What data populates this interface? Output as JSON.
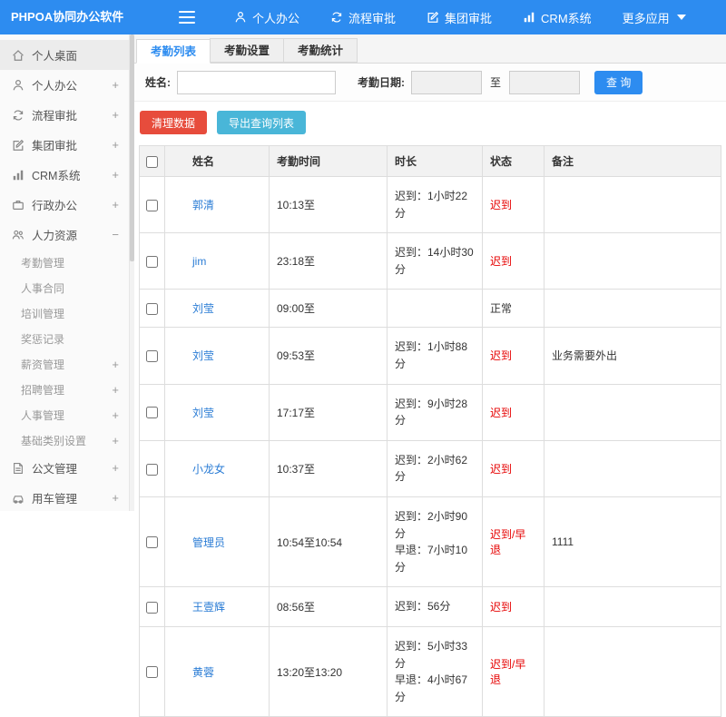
{
  "header": {
    "logo": "PHPOA协同办公软件",
    "nav": [
      {
        "label": "个人办公",
        "icon": "user-icon"
      },
      {
        "label": "流程审批",
        "icon": "process-icon"
      },
      {
        "label": "集团审批",
        "icon": "edit-icon"
      },
      {
        "label": "CRM系统",
        "icon": "chart-icon"
      },
      {
        "label": "更多应用",
        "icon": "chevron-down-icon"
      }
    ]
  },
  "sidebar": {
    "items": [
      {
        "label": "个人桌面",
        "icon": "home-icon",
        "active": true
      },
      {
        "label": "个人办公",
        "icon": "user-icon",
        "toggle": "+"
      },
      {
        "label": "流程审批",
        "icon": "process-icon",
        "toggle": "+"
      },
      {
        "label": "集团审批",
        "icon": "edit-icon",
        "toggle": "+"
      },
      {
        "label": "CRM系统",
        "icon": "chart-icon",
        "toggle": "+"
      },
      {
        "label": "行政办公",
        "icon": "briefcase-icon",
        "toggle": "+"
      },
      {
        "label": "人力资源",
        "icon": "people-icon",
        "toggle": "−",
        "expanded": true
      },
      {
        "label": "考勤管理",
        "sub": true
      },
      {
        "label": "人事合同",
        "sub": true
      },
      {
        "label": "培训管理",
        "sub": true
      },
      {
        "label": "奖惩记录",
        "sub": true
      },
      {
        "label": "薪资管理",
        "sub": true,
        "toggle": "+"
      },
      {
        "label": "招聘管理",
        "sub": true,
        "toggle": "+"
      },
      {
        "label": "人事管理",
        "sub": true,
        "toggle": "+"
      },
      {
        "label": "基础类别设置",
        "sub": true,
        "toggle": "+"
      },
      {
        "label": "公文管理",
        "icon": "doc-icon",
        "toggle": "+"
      },
      {
        "label": "用车管理",
        "icon": "car-icon",
        "toggle": "+"
      }
    ]
  },
  "tabs": [
    {
      "label": "考勤列表",
      "active": true
    },
    {
      "label": "考勤设置",
      "active": false
    },
    {
      "label": "考勤统计",
      "active": false
    }
  ],
  "filter": {
    "name_label": "姓名:",
    "name_value": "",
    "date_label": "考勤日期:",
    "to_label": "至",
    "date_from": "",
    "date_to": "",
    "search_button": "查 询"
  },
  "actions": {
    "clean_button": "清理数据",
    "export_button": "导出查询列表"
  },
  "table": {
    "headers": {
      "name": "姓名",
      "time": "考勤时间",
      "duration": "时长",
      "status": "状态",
      "note": "备注"
    },
    "rows": [
      {
        "name": "郭清",
        "time": "10:13至",
        "duration": "迟到：1小时22分",
        "status": "迟到",
        "note": ""
      },
      {
        "name": "jim",
        "time": "23:18至",
        "duration": "迟到：14小时30分",
        "status": "迟到",
        "note": ""
      },
      {
        "name": "刘莹",
        "time": "09:00至",
        "duration": "",
        "status": "正常",
        "note": ""
      },
      {
        "name": "刘莹",
        "time": "09:53至",
        "duration": "迟到：1小时88分",
        "status": "迟到",
        "note": "业务需要外出"
      },
      {
        "name": "刘莹",
        "time": "17:17至",
        "duration": "迟到：9小时28分",
        "status": "迟到",
        "note": ""
      },
      {
        "name": "小龙女",
        "time": "10:37至",
        "duration": "迟到：2小时62分",
        "status": "迟到",
        "note": ""
      },
      {
        "name": "管理员",
        "time": "10:54至10:54",
        "duration": "迟到：2小时90分\n早退：7小时10分",
        "status": "迟到/早退",
        "note": "1111"
      },
      {
        "name": "王壹辉",
        "time": "08:56至",
        "duration": "迟到：56分",
        "status": "迟到",
        "note": ""
      },
      {
        "name": "黄蓉",
        "time": "13:20至13:20",
        "duration": "迟到：5小时33分\n早退：4小时67分",
        "status": "迟到/早退",
        "note": ""
      }
    ]
  },
  "colors": {
    "header_bg": "#2d8cf0",
    "accent_blue": "#2d8cf0",
    "danger_red": "#e74c3c",
    "info_teal": "#49b6d8",
    "status_red": "#e60000",
    "link_blue": "#2a7cd5"
  }
}
